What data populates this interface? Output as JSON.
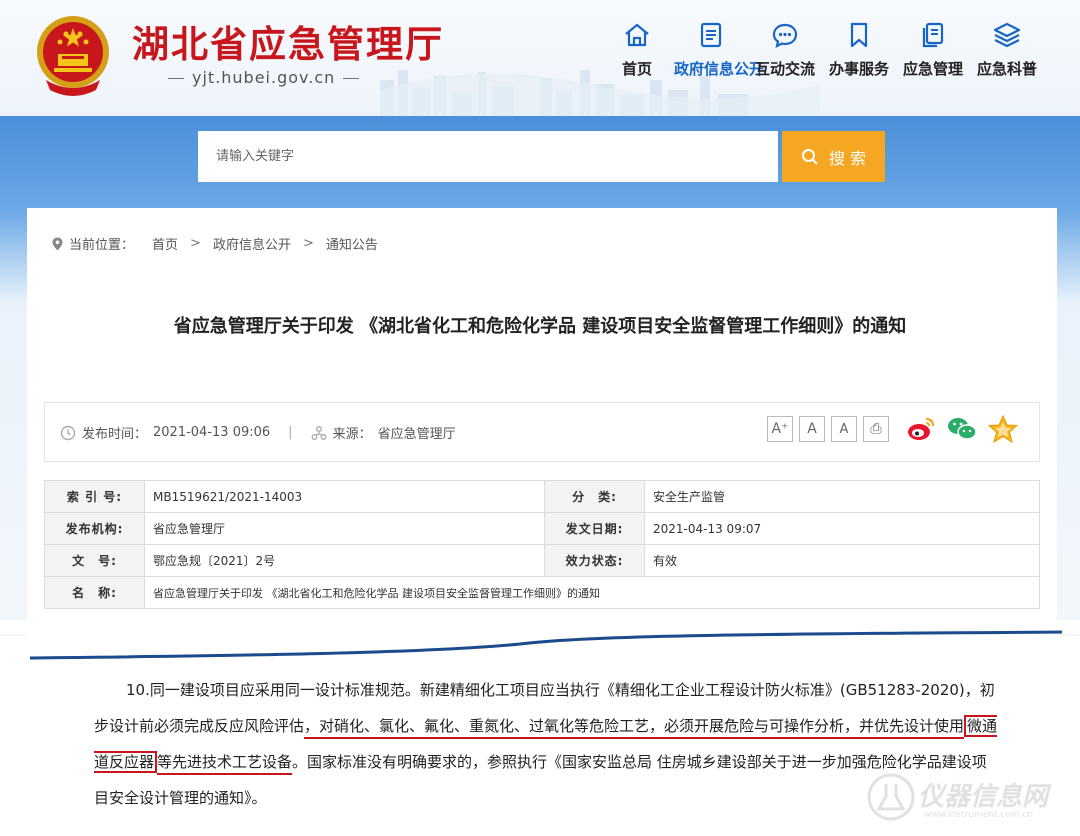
{
  "header": {
    "site_title": "湖北省应急管理厅",
    "site_domain": "yjt.hubei.gov.cn"
  },
  "nav": [
    {
      "label": "首页",
      "icon": "home-icon"
    },
    {
      "label": "政府信息公开",
      "icon": "document-list-icon",
      "active": true
    },
    {
      "label": "互动交流",
      "icon": "chat-bubble-icon"
    },
    {
      "label": "办事服务",
      "icon": "bookmark-icon"
    },
    {
      "label": "应急管理",
      "icon": "stacked-docs-icon"
    },
    {
      "label": "应急科普",
      "icon": "layers-icon"
    }
  ],
  "search": {
    "placeholder": "请输入关键字",
    "button_label": "搜 索"
  },
  "breadcrumb": {
    "prefix": "当前位置：",
    "items": [
      "首页",
      "政府信息公开",
      "通知公告"
    ]
  },
  "article": {
    "title": "省应急管理厅关于印发 《湖北省化工和危险化学品 建设项目安全监督管理工作细则》的通知",
    "publish_label": "发布时间：",
    "publish_time": "2021-04-13 09:06",
    "source_label": "来源：",
    "source": "省应急管理厅",
    "font_buttons": [
      "A⁺",
      "A",
      "A",
      "⎙"
    ]
  },
  "info_table": {
    "rows": [
      {
        "k1": "索 引 号:",
        "v1": "MB1519621/2021-14003",
        "k2": "分　类:",
        "v2": "安全生产监管"
      },
      {
        "k1": "发布机构:",
        "v1": "省应急管理厅",
        "k2": "发文日期:",
        "v2": "2021-04-13 09:07"
      },
      {
        "k1": "文　号:",
        "v1": "鄂应急规〔2021〕2号",
        "k2": "效力状态:",
        "v2": "有效"
      }
    ],
    "name_label": "名　称:",
    "name_value": "省应急管理厅关于印发 《湖北省化工和危险化学品 建设项目安全监督管理工作细则》的通知"
  },
  "excerpt": {
    "p1": "10.同一建设项目应采用同一设计标准规范。新建精细化工项目应当执行《精细化工企业工程设计防火标准》(GB51283-2020)，初步设计前必须完成反应风险评估",
    "p2": "，对硝化、氯化、氟化、重氮化、过氧化等危险工艺，必须开展危险与可操作分析，并优先设计使用",
    "p3": "微通道反应器",
    "p4": "等先进技术工艺设备",
    "p5": "。国家标准没有明确要求的，参照执行《国家安监总局 住房城乡建设部关于进一步加强危险化学品建设项目安全设计管理的通知》。"
  },
  "watermark": {
    "text": "仪器信息网",
    "url": "www.instrument.com.cn"
  },
  "colors": {
    "brand_red": "#c8161d",
    "nav_active": "#1766c5",
    "search_button": "#f5a623"
  }
}
